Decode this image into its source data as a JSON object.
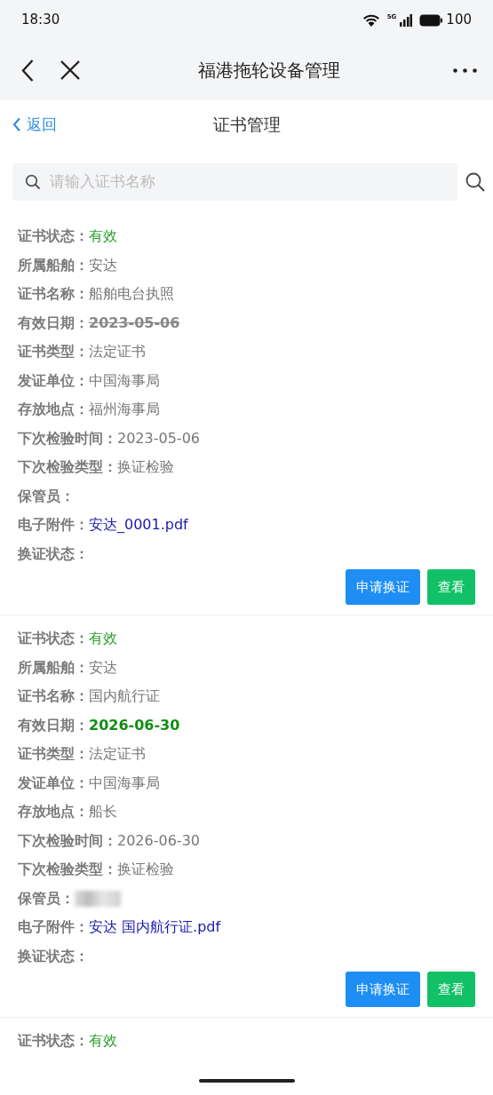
{
  "status_bar": {
    "time": "18:30",
    "network": "5G",
    "battery": "100"
  },
  "nav_bar": {
    "title": "福港拖轮设备管理"
  },
  "sub_header": {
    "back": "返回",
    "title": "证书管理"
  },
  "search": {
    "placeholder": "请输入证书名称"
  },
  "certificates": [
    {
      "fields": [
        {
          "kind": "status",
          "label": "证书状态：",
          "value": "有效"
        },
        {
          "kind": "text",
          "label": "所属船舶：",
          "value": "安达"
        },
        {
          "kind": "text",
          "label": "证书名称：",
          "value": "船舶电台执照"
        },
        {
          "kind": "date",
          "label": "有效日期：",
          "value": "2023-05-06",
          "expired": true
        },
        {
          "kind": "text",
          "label": "证书类型：",
          "value": "法定证书"
        },
        {
          "kind": "text",
          "label": "发证单位：",
          "value": "中国海事局"
        },
        {
          "kind": "text",
          "label": "存放地点：",
          "value": "福州海事局"
        },
        {
          "kind": "text",
          "label": "下次检验时间：",
          "value": "2023-05-06"
        },
        {
          "kind": "text",
          "label": "下次检验类型：",
          "value": "换证检验"
        },
        {
          "kind": "text",
          "label": "保管员：",
          "redacted": false
        },
        {
          "kind": "link",
          "label": "电子附件：",
          "value": "安达_0001.pdf"
        },
        {
          "kind": "text",
          "label": "换证状态："
        }
      ],
      "buttons": [
        {
          "label": "申请换证",
          "kind": "primary"
        },
        {
          "label": "查看",
          "kind": "success"
        }
      ]
    },
    {
      "fields": [
        {
          "kind": "status",
          "label": "证书状态：",
          "value": "有效"
        },
        {
          "kind": "text",
          "label": "所属船舶：",
          "value": "安达"
        },
        {
          "kind": "text",
          "label": "证书名称：",
          "value": "国内航行证"
        },
        {
          "kind": "date",
          "label": "有效日期：",
          "value": "2026-06-30",
          "expired": false
        },
        {
          "kind": "text",
          "label": "证书类型：",
          "value": "法定证书"
        },
        {
          "kind": "text",
          "label": "发证单位：",
          "value": "中国海事局"
        },
        {
          "kind": "text",
          "label": "存放地点：",
          "value": "船长"
        },
        {
          "kind": "text",
          "label": "下次检验时间：",
          "value": "2026-06-30"
        },
        {
          "kind": "text",
          "label": "下次检验类型：",
          "value": "换证检验"
        },
        {
          "kind": "text",
          "label": "保管员：",
          "redacted": true
        },
        {
          "kind": "link",
          "label": "电子附件：",
          "value": "安达 国内航行证.pdf"
        },
        {
          "kind": "text",
          "label": "换证状态："
        }
      ],
      "buttons": [
        {
          "label": "申请换证",
          "kind": "primary"
        },
        {
          "label": "查看",
          "kind": "success"
        }
      ]
    },
    {
      "fields": [
        {
          "kind": "status",
          "label": "证书状态：",
          "value": "有效"
        }
      ]
    }
  ]
}
